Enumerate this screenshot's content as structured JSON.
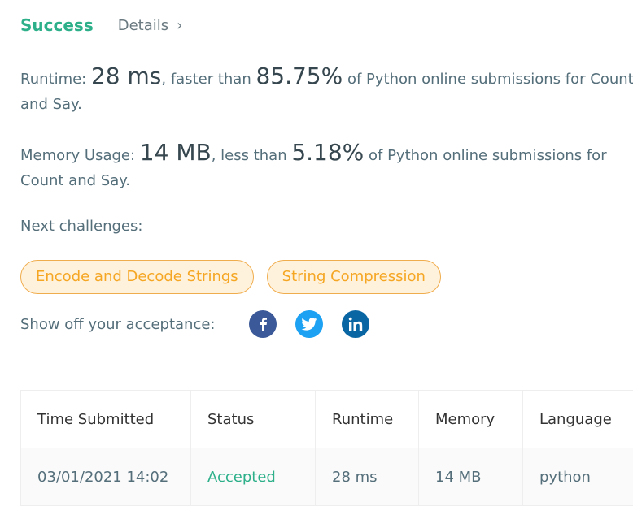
{
  "header": {
    "title": "Success",
    "details_label": "Details",
    "chevron": "›"
  },
  "runtime": {
    "prefix": "Runtime: ",
    "value": "28 ms",
    "mid": ", faster than ",
    "percent": "85.75%",
    "suffix": " of Python online submissions for Count and Say."
  },
  "memory": {
    "prefix": "Memory Usage: ",
    "value": "14 MB",
    "mid": ", less than ",
    "percent": "5.18%",
    "suffix": " of Python online submissions for Count and Say."
  },
  "next": {
    "label": "Next challenges:",
    "items": [
      {
        "label": "Encode and Decode Strings"
      },
      {
        "label": "String Compression"
      }
    ]
  },
  "share": {
    "label": "Show off your acceptance:",
    "icons": [
      "facebook-icon",
      "twitter-icon",
      "linkedin-icon"
    ]
  },
  "table": {
    "headers": [
      "Time Submitted",
      "Status",
      "Runtime",
      "Memory",
      "Language"
    ],
    "rows": [
      {
        "time": "03/01/2021 14:02",
        "status": "Accepted",
        "runtime": "28 ms",
        "memory": "14 MB",
        "language": "python"
      }
    ]
  },
  "colors": {
    "success": "#2db08a",
    "tag_text": "#f5a623",
    "tag_bg": "#fff2dc",
    "facebook": "#3b5998",
    "twitter": "#1da1f2",
    "linkedin": "#0a66a3"
  }
}
